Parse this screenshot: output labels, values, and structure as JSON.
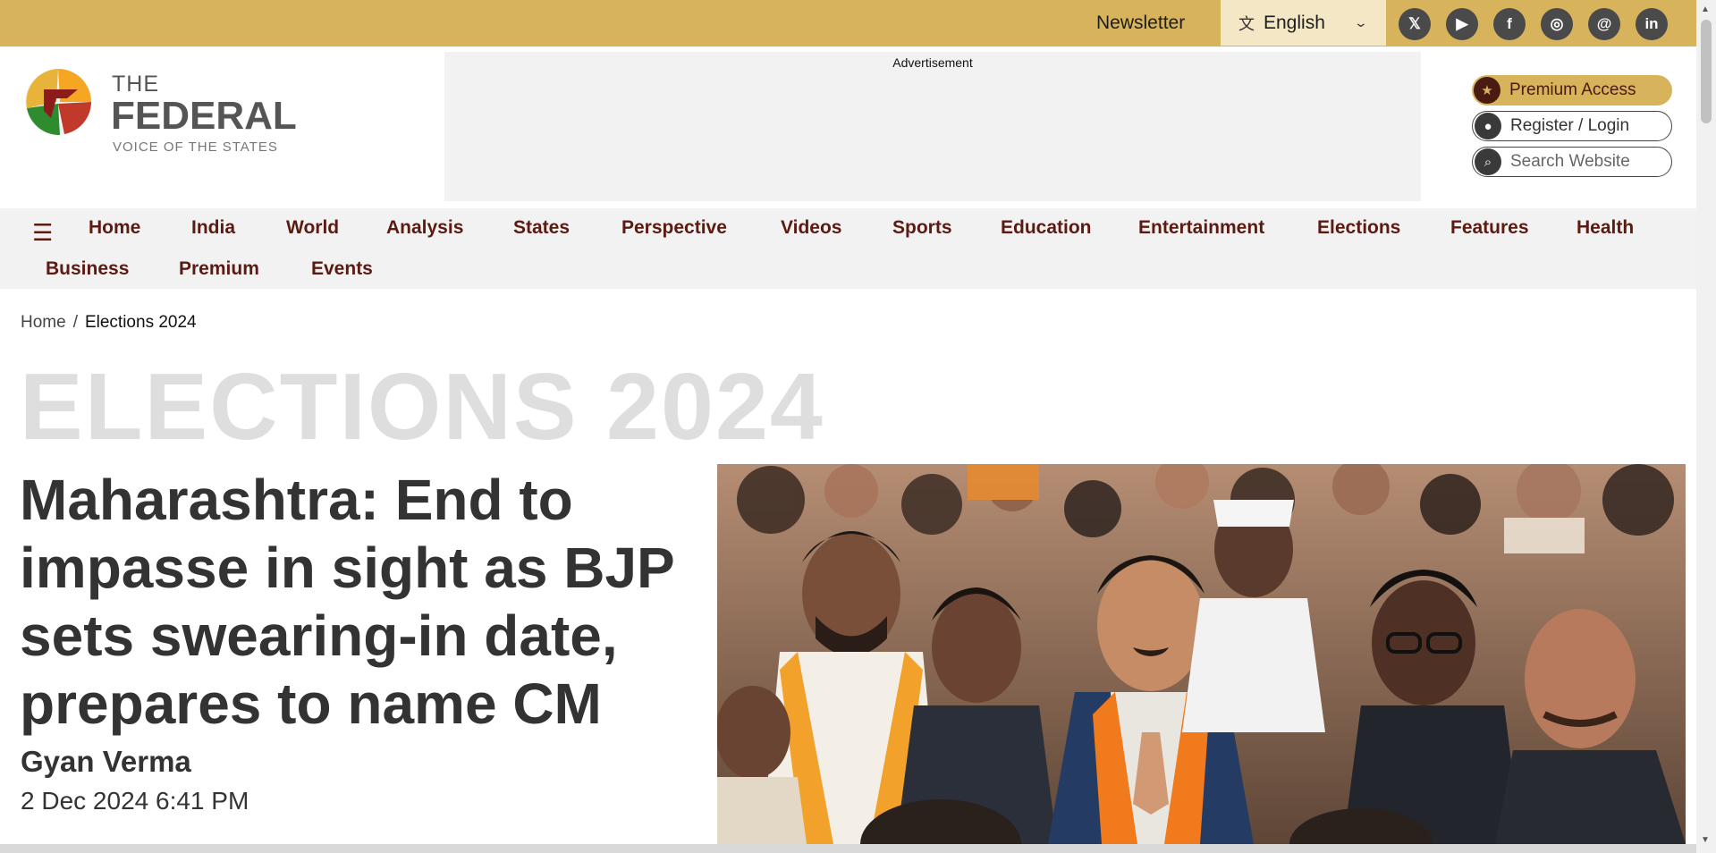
{
  "topbar": {
    "newsletter_label": "Newsletter",
    "language": {
      "label": "English",
      "icon": "translate-icon"
    },
    "socials": [
      {
        "name": "x-icon",
        "glyph": "𝕏"
      },
      {
        "name": "youtube-icon",
        "glyph": "▶"
      },
      {
        "name": "facebook-icon",
        "glyph": "f"
      },
      {
        "name": "instagram-icon",
        "glyph": "◎"
      },
      {
        "name": "threads-icon",
        "glyph": "@"
      },
      {
        "name": "linkedin-icon",
        "glyph": "in"
      }
    ]
  },
  "brand": {
    "the": "THE",
    "name": "FEDERAL",
    "tagline": "VOICE OF THE STATES"
  },
  "ad": {
    "label": "Advertisement"
  },
  "account": {
    "premium_label": "Premium Access",
    "register_label": "Register / Login",
    "search_placeholder": "Search Website"
  },
  "nav": {
    "row1": [
      "Home",
      "India",
      "World",
      "Analysis",
      "States",
      "Perspective",
      "Videos",
      "Sports",
      "Education",
      "Entertainment",
      "Elections",
      "Features",
      "Health"
    ],
    "row2": [
      "Business",
      "Premium",
      "Events"
    ]
  },
  "breadcrumb": {
    "home": "Home",
    "separator": "/",
    "current": "Elections 2024"
  },
  "article": {
    "section": "ELECTIONS 2024",
    "headline": "Maharashtra: End to impasse in sight as BJP sets swearing-in date, prepares to name CM",
    "author": "Gyan Verma",
    "date": "2 Dec 2024 6:41 PM"
  },
  "colors": {
    "topbar": "#d7b35c",
    "nav_text": "#5b1a12",
    "nav_bg": "#f2f2f2"
  }
}
